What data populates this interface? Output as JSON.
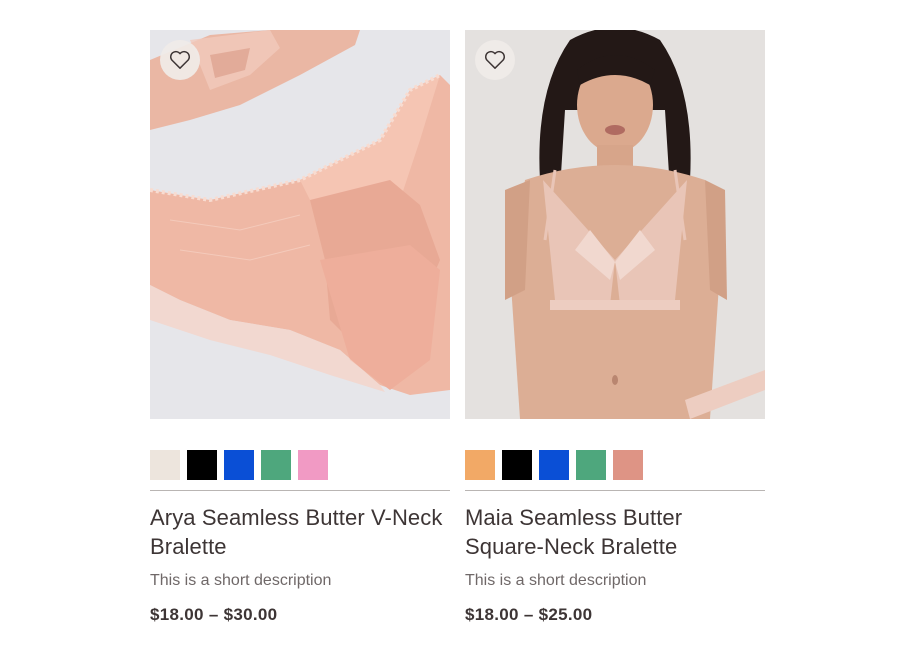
{
  "products": [
    {
      "title": "Arya Seamless Butter V-Neck Bralette",
      "description": "This is a short description",
      "price": "$18.00 – $30.00",
      "swatch_colors": [
        "#ede5dd",
        "#000000",
        "#0a4fd6",
        "#4ea77d",
        "#f19ac4"
      ],
      "image": "flat-lay of peach lace panty",
      "wishlist_icon": "heart-outline-icon"
    },
    {
      "title": "Maia Seamless Butter Square-Neck Bralette",
      "description": "This is a short description",
      "price": "$18.00 – $25.00",
      "swatch_colors": [
        "#f2a966",
        "#000000",
        "#0a4fd6",
        "#4ea77d",
        "#de9485"
      ],
      "image": "model wearing nude lace bralette",
      "wishlist_icon": "heart-outline-icon"
    }
  ]
}
